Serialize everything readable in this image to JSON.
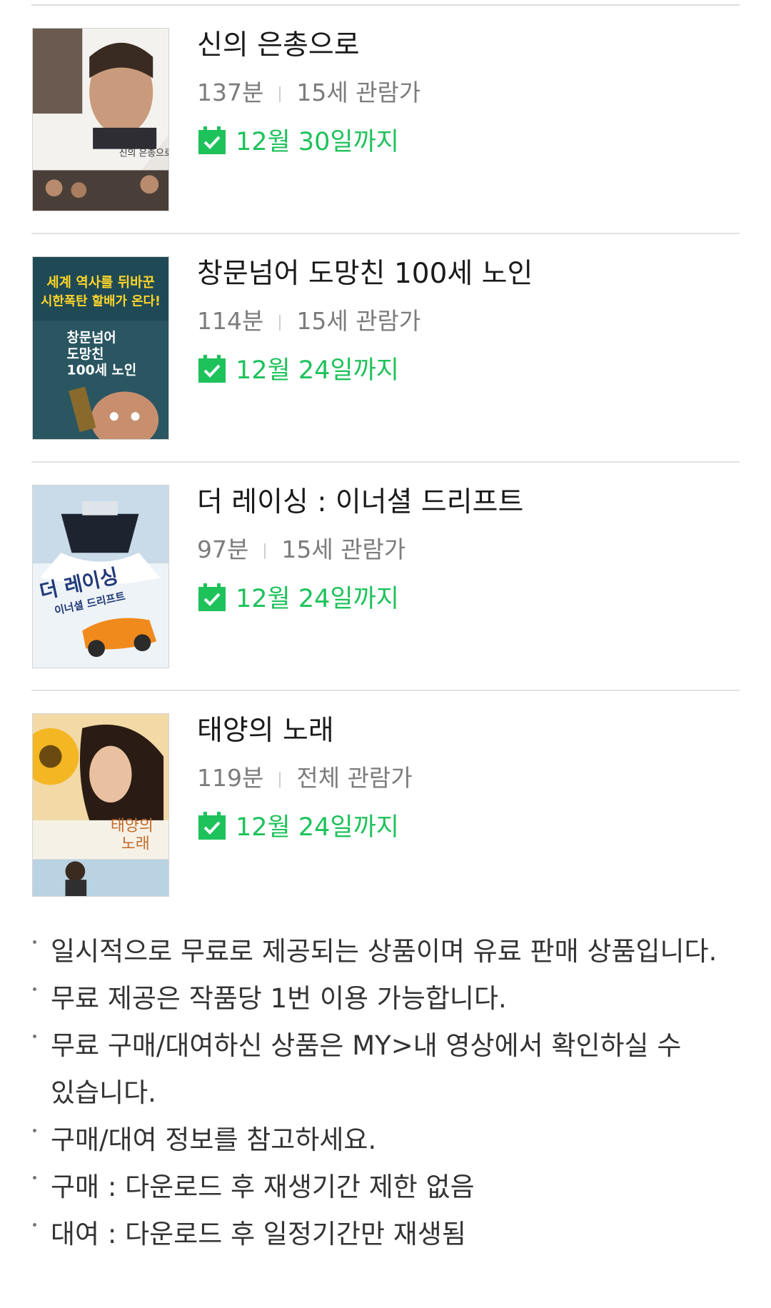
{
  "accent_color": "#1ec25b",
  "movies": [
    {
      "title": "신의 은총으로",
      "duration": "137분",
      "rating": "15세 관람가",
      "deadline": "12월 30일까지",
      "poster_icon": "poster-image",
      "poster_text": "신의 은총으로"
    },
    {
      "title": "창문넘어 도망친 100세 노인",
      "duration": "114분",
      "rating": "15세 관람가",
      "deadline": "12월 24일까지",
      "poster_icon": "poster-image",
      "poster_text": {
        "line1": "세계 역사를 뒤바꾼",
        "line2": "시한폭탄 할배가 온다!",
        "line3": "창문넘어",
        "line4": "도망친",
        "line5": "100세 노인"
      }
    },
    {
      "title": "더 레이싱 : 이너셜 드리프트",
      "duration": "97분",
      "rating": "15세 관람가",
      "deadline": "12월 24일까지",
      "poster_icon": "poster-image",
      "poster_text": {
        "line1": "더 레이싱",
        "line2": "이너셜 드리프트"
      }
    },
    {
      "title": "태양의 노래",
      "duration": "119분",
      "rating": "전체 관람가",
      "deadline": "12월 24일까지",
      "poster_icon": "poster-image",
      "poster_text": {
        "line1": "태양의",
        "line2": "노래"
      }
    }
  ],
  "notes": [
    "일시적으로 무료로 제공되는 상품이며 유료 판매 상품입니다.",
    "무료 제공은 작품당 1번 이용 가능합니다.",
    "무료 구매/대여하신 상품은 MY>내 영상에서 확인하실 수 있습니다.",
    "구매/대여 정보를 참고하세요.",
    "구매 : 다운로드 후 재생기간 제한 없음",
    "대여 : 다운로드 후 일정기간만 재생됨"
  ]
}
